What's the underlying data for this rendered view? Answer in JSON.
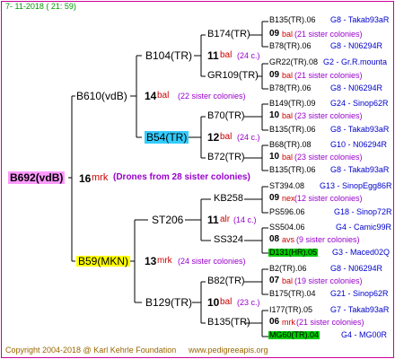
{
  "header_date": "7- 11-2018 ( 21: 59)",
  "footer": {
    "copyright": "Copyright 2004-2018 @ Karl Kehrle Foundation",
    "site": "www.pedigreeapis.org"
  },
  "root": {
    "name": "B692(vdB)",
    "num": "16",
    "mrk": "mrk",
    "drones": "(Drones from 28 sister colonies)"
  },
  "sire": {
    "name": "B610(vdB)",
    "num": "14",
    "mrk": "bal",
    "note": "(22 sister colonies)"
  },
  "dam": {
    "name": "B59(MKN)",
    "num": "13",
    "mrk": "mrk",
    "note": "(24 sister colonies)"
  },
  "b104": {
    "name": "B104(TR)",
    "num": "11",
    "mrk": "bal",
    "note": "(24 c.)"
  },
  "b54": {
    "name": "B54(TR)",
    "num": "12",
    "mrk": "bal",
    "note": "(24 c.)"
  },
  "st206": {
    "name": "ST206",
    "num": "11",
    "mrk": "alr",
    "note": "(14 c.)"
  },
  "b129": {
    "name": "B129(TR)",
    "num": "10",
    "mrk": "bal",
    "note": "(23 c.)"
  },
  "b174": {
    "name": "B174(TR)",
    "num": "09",
    "mrk": "bal",
    "note": "(21 sister colonies)"
  },
  "gr109": {
    "name": "GR109(TR)",
    "num": "09",
    "mrk": "bal",
    "note": "(21 sister colonies)"
  },
  "b70": {
    "name": "B70(TR)",
    "num": "10",
    "mrk": "bal",
    "note": "(23 sister colonies)"
  },
  "b72": {
    "name": "B72(TR)",
    "num": "10",
    "mrk": "bal",
    "note": "(23 sister colonies)"
  },
  "kb258": {
    "name": "KB258",
    "num": "09",
    "mrk": "nex",
    "note": "(12 sister colonies)"
  },
  "ss324": {
    "name": "SS324",
    "num": "08",
    "mrk": "avs",
    "note": "(9 sister colonies)"
  },
  "b82": {
    "name": "B82(TR)",
    "num": "07",
    "mrk": "bal",
    "note": "(19 sister colonies)"
  },
  "b135b": {
    "name": "B135(TR)",
    "num": "06",
    "mrk": "mrk",
    "note": "(21 sister colonies)"
  },
  "leaves": [
    {
      "left": "B135(TR).06",
      "right": "G8 - Takab93aR"
    },
    {
      "left": "B78(TR).06",
      "right": "G8 - N06294R"
    },
    {
      "left": "GR22(TR).08",
      "right": "G2 - Gr.R.mounta"
    },
    {
      "left": "B78(TR).06",
      "right": "G8 - N06294R"
    },
    {
      "left": "B149(TR).09",
      "right": "G24 - Sinop62R"
    },
    {
      "left": "B135(TR).06",
      "right": "G8 - Takab93aR"
    },
    {
      "left": "B68(TR).08",
      "right": "G10 - N06294R"
    },
    {
      "left": "B135(TR).06",
      "right": "G8 - Takab93aR"
    },
    {
      "left": "ST394.08",
      "right": "G13 - SinopEgg86R"
    },
    {
      "left": "PS596.06",
      "right": "G18 - Sinop72R"
    },
    {
      "left": "SS504.06",
      "right": "G4 - Camic99R"
    },
    {
      "left": "D131(HR).05",
      "right": "G3 - Maced02Q"
    },
    {
      "left": "B2(TR).06",
      "right": "G8 - N06294R"
    },
    {
      "left": "B175(TR).04",
      "right": "G21 - Sinop62R"
    },
    {
      "left": "I177(TR).05",
      "right": "G7 - Takab93aR"
    },
    {
      "left": "MG60(TR).04",
      "right": "G4 - MG00R"
    }
  ]
}
